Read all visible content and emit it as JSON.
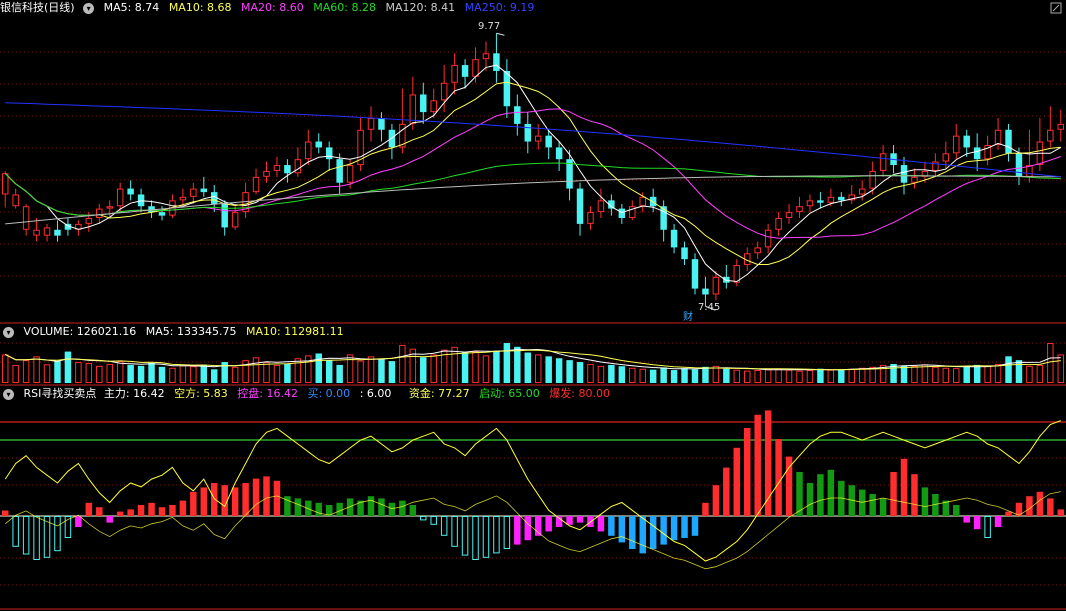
{
  "colors": {
    "up": "#ff2d2d",
    "down": "#4bf2f2",
    "ma5": "#ffffff",
    "ma10": "#ffff55",
    "ma20": "#ff40ff",
    "ma60": "#22dd22",
    "ma120": "#bbbbbb",
    "ma250": "#2233ff",
    "separator": "#cc2222",
    "grid": "#7a1212",
    "rsi_red_line": "#dd2222",
    "rsi_green_line": "#33cc33",
    "rsi_curve": "#ffff33",
    "zero_line": "#ffffdd",
    "magenta_bar": "#ff22ff",
    "blue_bar": "#1ea7ff",
    "green_bar": "#139a13"
  },
  "price_panel": {
    "title": "银信科技(日线)",
    "indicators": [
      {
        "label": "MA5: 8.74",
        "color": "#ffffff"
      },
      {
        "label": "MA10: 8.68",
        "color": "#ffff55"
      },
      {
        "label": "MA20: 8.60",
        "color": "#ff40ff"
      },
      {
        "label": "MA60: 8.28",
        "color": "#22dd22"
      },
      {
        "label": "MA120: 8.41",
        "color": "#cccccc"
      },
      {
        "label": "MA250: 9.19",
        "color": "#3344ff"
      }
    ],
    "high_label": "9.77",
    "low_label": "7.45",
    "marker_label": "财"
  },
  "volume_panel": {
    "items": [
      {
        "label": "VOLUME: 126021.16",
        "color": "#ffffff"
      },
      {
        "label": "MA5: 133345.75",
        "color": "#ffffff"
      },
      {
        "label": "MA10: 112981.11",
        "color": "#ffff55"
      }
    ]
  },
  "rsi_panel": {
    "items": [
      {
        "label": "RSI寻找买卖点",
        "color": "#ffffff"
      },
      {
        "label": "主力: 16.42",
        "color": "#ffffff"
      },
      {
        "label": "空方: 5.83",
        "color": "#ffff55"
      },
      {
        "label": "控盘: 16.42",
        "color": "#ff40ff"
      },
      {
        "label": "买: 0.00",
        "color": "#3388ff"
      },
      {
        "label": ": 6.00",
        "color": "#ffffff"
      },
      {
        "label": "资金: 77.27",
        "color": "#ffff55"
      },
      {
        "label": "启动: 65.00",
        "color": "#22dd22"
      },
      {
        "label": "爆发: 80.00",
        "color": "#ff2d2d"
      }
    ]
  },
  "chart_data": {
    "type": "candlestick",
    "price_axis_range": [
      7.35,
      9.9
    ],
    "high_value": 9.77,
    "low_value": 7.45,
    "candles": [
      [
        8.4,
        8.58,
        8.29,
        8.6
      ],
      [
        8.3,
        8.4,
        8.28,
        8.45
      ],
      [
        8.1,
        8.3,
        8.05,
        8.32
      ],
      [
        8.05,
        8.1,
        8.0,
        8.2
      ],
      [
        8.05,
        8.12,
        8.0,
        8.15
      ],
      [
        8.1,
        8.05,
        8.0,
        8.18
      ],
      [
        8.15,
        8.1,
        8.05,
        8.2
      ],
      [
        8.1,
        8.15,
        8.05,
        8.18
      ],
      [
        8.15,
        8.2,
        8.08,
        8.25
      ],
      [
        8.2,
        8.28,
        8.15,
        8.32
      ],
      [
        8.28,
        8.3,
        8.2,
        8.35
      ],
      [
        8.3,
        8.45,
        8.25,
        8.5
      ],
      [
        8.45,
        8.4,
        8.35,
        8.52
      ],
      [
        8.4,
        8.3,
        8.25,
        8.45
      ],
      [
        8.3,
        8.25,
        8.2,
        8.35
      ],
      [
        8.25,
        8.22,
        8.18,
        8.3
      ],
      [
        8.22,
        8.35,
        8.2,
        8.4
      ],
      [
        8.35,
        8.38,
        8.3,
        8.45
      ],
      [
        8.38,
        8.45,
        8.32,
        8.5
      ],
      [
        8.45,
        8.42,
        8.38,
        8.55
      ],
      [
        8.42,
        8.32,
        8.25,
        8.48
      ],
      [
        8.32,
        8.12,
        8.05,
        8.35
      ],
      [
        8.12,
        8.25,
        8.1,
        8.3
      ],
      [
        8.25,
        8.42,
        8.2,
        8.5
      ],
      [
        8.42,
        8.55,
        8.4,
        8.62
      ],
      [
        8.55,
        8.6,
        8.5,
        8.68
      ],
      [
        8.6,
        8.65,
        8.55,
        8.72
      ],
      [
        8.65,
        8.58,
        8.5,
        8.7
      ],
      [
        8.58,
        8.7,
        8.55,
        8.8
      ],
      [
        8.7,
        8.85,
        8.65,
        8.95
      ],
      [
        8.85,
        8.8,
        8.75,
        8.92
      ],
      [
        8.8,
        8.7,
        8.6,
        8.85
      ],
      [
        8.7,
        8.5,
        8.4,
        8.75
      ],
      [
        8.5,
        8.65,
        8.45,
        8.7
      ],
      [
        8.65,
        8.95,
        8.6,
        9.05
      ],
      [
        8.95,
        9.05,
        8.85,
        9.15
      ],
      [
        9.05,
        8.95,
        8.85,
        9.1
      ],
      [
        8.95,
        8.8,
        8.7,
        9.0
      ],
      [
        8.8,
        9.0,
        8.75,
        9.3
      ],
      [
        9.0,
        9.25,
        8.95,
        9.4
      ],
      [
        9.25,
        9.1,
        9.0,
        9.35
      ],
      [
        9.1,
        9.2,
        9.05,
        9.3
      ],
      [
        9.2,
        9.35,
        9.1,
        9.5
      ],
      [
        9.35,
        9.5,
        9.25,
        9.6
      ],
      [
        9.5,
        9.4,
        9.3,
        9.55
      ],
      [
        9.4,
        9.55,
        9.35,
        9.65
      ],
      [
        9.55,
        9.6,
        9.45,
        9.7
      ],
      [
        9.6,
        9.45,
        9.35,
        9.77
      ],
      [
        9.45,
        9.15,
        9.05,
        9.55
      ],
      [
        9.15,
        9.0,
        8.9,
        9.25
      ],
      [
        9.0,
        8.85,
        8.75,
        9.1
      ],
      [
        8.85,
        8.9,
        8.78,
        9.0
      ],
      [
        8.9,
        8.8,
        8.7,
        8.95
      ],
      [
        8.8,
        8.7,
        8.6,
        8.85
      ],
      [
        8.7,
        8.45,
        8.35,
        8.78
      ],
      [
        8.45,
        8.15,
        8.05,
        8.5
      ],
      [
        8.15,
        8.25,
        8.1,
        8.3
      ],
      [
        8.25,
        8.35,
        8.2,
        8.45
      ],
      [
        8.35,
        8.28,
        8.22,
        8.4
      ],
      [
        8.28,
        8.2,
        8.15,
        8.32
      ],
      [
        8.2,
        8.3,
        8.18,
        8.35
      ],
      [
        8.3,
        8.38,
        8.25,
        8.42
      ],
      [
        8.38,
        8.3,
        8.25,
        8.45
      ],
      [
        8.3,
        8.1,
        8.0,
        8.35
      ],
      [
        8.1,
        7.95,
        7.9,
        8.15
      ],
      [
        7.95,
        7.85,
        7.8,
        8.0
      ],
      [
        7.85,
        7.6,
        7.55,
        7.9
      ],
      [
        7.6,
        7.55,
        7.45,
        7.7
      ],
      [
        7.55,
        7.7,
        7.5,
        7.75
      ],
      [
        7.7,
        7.65,
        7.6,
        7.8
      ],
      [
        7.65,
        7.8,
        7.62,
        7.85
      ],
      [
        7.8,
        7.9,
        7.75,
        7.95
      ],
      [
        7.9,
        7.95,
        7.85,
        8.0
      ],
      [
        7.95,
        8.1,
        7.9,
        8.15
      ],
      [
        8.1,
        8.2,
        8.05,
        8.25
      ],
      [
        8.2,
        8.25,
        8.15,
        8.32
      ],
      [
        8.25,
        8.3,
        8.2,
        8.38
      ],
      [
        8.3,
        8.35,
        8.25,
        8.4
      ],
      [
        8.35,
        8.33,
        8.28,
        8.42
      ],
      [
        8.33,
        8.38,
        8.3,
        8.45
      ],
      [
        8.38,
        8.35,
        8.3,
        8.42
      ],
      [
        8.35,
        8.4,
        8.32,
        8.48
      ],
      [
        8.4,
        8.45,
        8.35,
        8.52
      ],
      [
        8.45,
        8.6,
        8.4,
        8.68
      ],
      [
        8.6,
        8.75,
        8.55,
        8.82
      ],
      [
        8.75,
        8.65,
        8.58,
        8.82
      ],
      [
        8.65,
        8.5,
        8.4,
        8.72
      ],
      [
        8.5,
        8.55,
        8.45,
        8.62
      ],
      [
        8.55,
        8.6,
        8.5,
        8.68
      ],
      [
        8.6,
        8.68,
        8.55,
        8.75
      ],
      [
        8.68,
        8.75,
        8.62,
        8.85
      ],
      [
        8.75,
        8.9,
        8.7,
        9.0
      ],
      [
        8.9,
        8.8,
        8.72,
        8.95
      ],
      [
        8.8,
        8.7,
        8.6,
        8.92
      ],
      [
        8.7,
        8.82,
        8.65,
        8.9
      ],
      [
        8.82,
        8.95,
        8.78,
        9.05
      ],
      [
        8.95,
        8.75,
        8.68,
        9.0
      ],
      [
        8.75,
        8.55,
        8.48,
        8.8
      ],
      [
        8.55,
        8.65,
        8.5,
        8.95
      ],
      [
        8.65,
        8.85,
        8.6,
        9.05
      ],
      [
        8.85,
        8.95,
        8.8,
        9.15
      ],
      [
        8.95,
        9.0,
        8.85,
        9.12
      ]
    ],
    "volume": [
      150,
      95,
      120,
      140,
      98,
      115,
      165,
      110,
      105,
      90,
      100,
      115,
      95,
      90,
      105,
      85,
      80,
      92,
      88,
      96,
      72,
      110,
      85,
      120,
      135,
      110,
      95,
      100,
      130,
      145,
      155,
      120,
      95,
      150,
      118,
      140,
      125,
      115,
      200,
      180,
      135,
      150,
      175,
      190,
      160,
      165,
      145,
      170,
      210,
      190,
      160,
      150,
      140,
      130,
      120,
      110,
      100,
      90,
      95,
      88,
      80,
      75,
      70,
      82,
      68,
      78,
      72,
      85,
      90,
      75,
      70,
      65,
      68,
      72,
      75,
      70,
      65,
      68,
      75,
      70,
      72,
      75,
      80,
      85,
      95,
      100,
      92,
      90,
      98,
      85,
      80,
      78,
      88,
      95,
      90,
      100,
      140,
      120,
      90,
      95,
      210,
      150,
      135
    ],
    "volume_ma5": [],
    "rsi_curve": [
      62,
      70,
      74,
      68,
      64,
      60,
      66,
      70,
      62,
      55,
      50,
      56,
      60,
      58,
      62,
      64,
      68,
      60,
      56,
      62,
      52,
      48,
      60,
      70,
      80,
      86,
      88,
      84,
      80,
      76,
      72,
      70,
      74,
      78,
      82,
      84,
      80,
      76,
      78,
      82,
      84,
      86,
      80,
      78,
      74,
      80,
      84,
      88,
      82,
      72,
      62,
      54,
      46,
      42,
      38,
      36,
      40,
      44,
      48,
      50,
      46,
      42,
      38,
      34,
      30,
      28,
      24,
      20,
      22,
      26,
      30,
      36,
      44,
      52,
      60,
      68,
      74,
      80,
      84,
      86,
      86,
      84,
      82,
      84,
      86,
      84,
      82,
      80,
      78,
      80,
      82,
      84,
      86,
      84,
      80,
      78,
      74,
      70,
      76,
      84,
      90,
      92,
      88
    ],
    "main_bars": [
      5,
      -28,
      -35,
      -40,
      -38,
      -32,
      -20,
      -10,
      12,
      8,
      -6,
      4,
      6,
      10,
      12,
      8,
      10,
      14,
      22,
      26,
      30,
      28,
      26,
      30,
      34,
      36,
      32,
      18,
      16,
      14,
      12,
      10,
      12,
      16,
      14,
      18,
      16,
      12,
      14,
      10,
      -4,
      -8,
      -18,
      -28,
      -36,
      -40,
      -38,
      -34,
      -30,
      -26,
      -22,
      -18,
      -14,
      -10,
      -8,
      -6,
      -10,
      -14,
      -18,
      -24,
      -30,
      -34,
      -30,
      -26,
      -22,
      -20,
      -18,
      12,
      28,
      44,
      62,
      80,
      92,
      96,
      70,
      54,
      40,
      30,
      38,
      42,
      32,
      28,
      24,
      20,
      16,
      40,
      52,
      38,
      26,
      20,
      14,
      10,
      -6,
      -12,
      -20,
      -10,
      4,
      12,
      18,
      22,
      16,
      6,
      -2
    ],
    "rsi_thresholds": [
      80,
      65
    ]
  }
}
